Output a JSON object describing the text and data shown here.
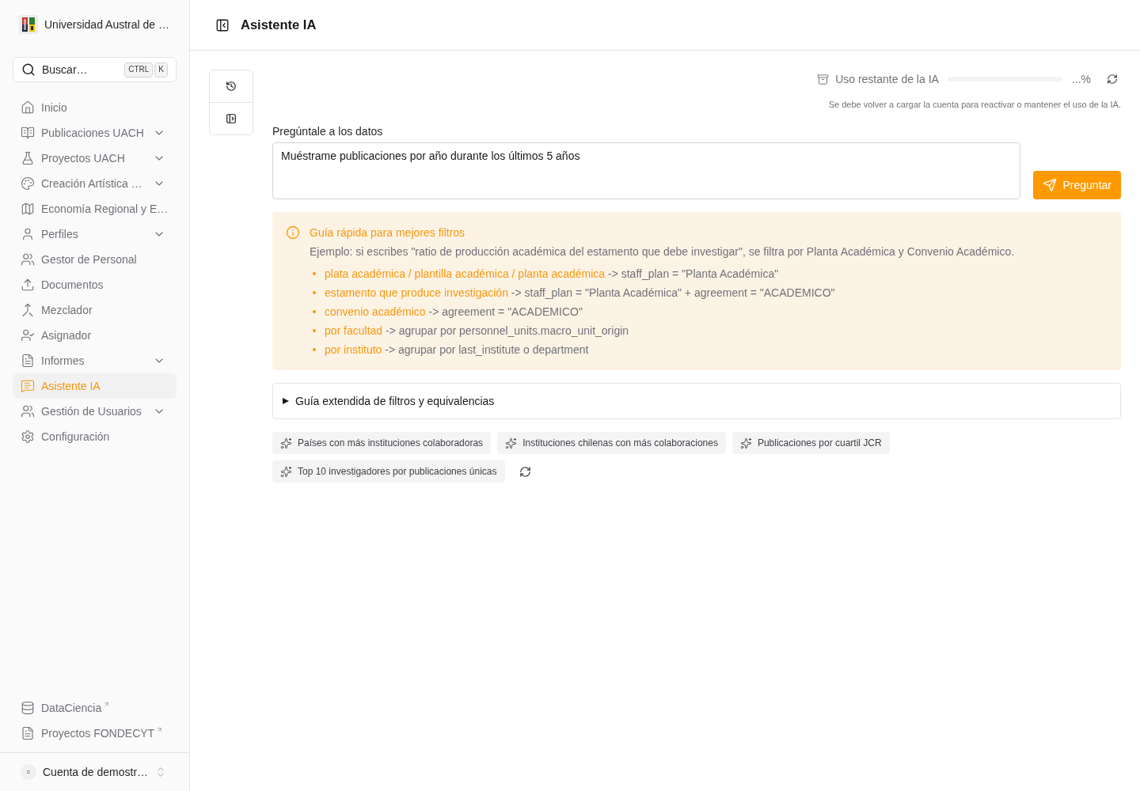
{
  "sidebar": {
    "organization": "Universidad Austral de …",
    "search": {
      "label": "Buscar…",
      "shortcut": [
        "CTRL",
        "K"
      ]
    },
    "nav_items": [
      {
        "label": "Inicio",
        "submenu": false,
        "selected": false
      },
      {
        "label": "Publicaciones UACH",
        "submenu": true,
        "selected": false
      },
      {
        "label": "Proyectos UACH",
        "submenu": true,
        "selected": false
      },
      {
        "label": "Creación Artística …",
        "submenu": true,
        "selected": false
      },
      {
        "label": "Economía Regional y E…",
        "submenu": false,
        "selected": false
      },
      {
        "label": "Perfiles",
        "submenu": true,
        "selected": false
      },
      {
        "label": "Gestor de Personal",
        "submenu": false,
        "selected": false
      },
      {
        "label": "Documentos",
        "submenu": false,
        "selected": false
      },
      {
        "label": "Mezclador",
        "submenu": false,
        "selected": false
      },
      {
        "label": "Asignador",
        "submenu": false,
        "selected": false
      },
      {
        "label": "Informes",
        "submenu": true,
        "selected": false
      },
      {
        "label": "Asistente IA",
        "submenu": false,
        "selected": true
      },
      {
        "label": "Gestión de Usuarios",
        "submenu": true,
        "selected": false
      },
      {
        "label": "Configuración",
        "submenu": false,
        "selected": false
      }
    ],
    "external_links": [
      {
        "label": "DataCiencia"
      },
      {
        "label": "Proyectos FONDECYT"
      }
    ],
    "account": {
      "initial": "c",
      "name": "Cuenta de demostr…"
    }
  },
  "header": {
    "title": "Asistente IA"
  },
  "usage": {
    "label": "Uso restante de la IA",
    "level": 0,
    "reading": "...%",
    "note": "Se debe volver a cargar la cuenta para reactivar o mantener el uso de la IA."
  },
  "query": {
    "label": "Pregúntale a los datos",
    "value": "Muéstrame publicaciones por año durante los últimos 5 años",
    "submit": "Preguntar"
  },
  "quick_guide": {
    "title": "Guía rápida para mejores filtros",
    "example": "Ejemplo: si escribes \"ratio de producción académica del estamento que debe investigar\", se filtra por Planta Académica y Convenio Académico.",
    "rules": [
      {
        "term": "plata académica / plantilla académica / planta académica",
        "mapping": " -> staff_plan = \"Planta Académica\""
      },
      {
        "term": "estamento que produce investigación",
        "mapping": " -> staff_plan = \"Planta Académica\" + agreement = \"ACADEMICO\""
      },
      {
        "term": "convenio académico",
        "mapping": " -> agreement = \"ACADEMICO\""
      },
      {
        "term": "por facultad",
        "mapping": " -> agrupar por personnel_units.macro_unit_origin"
      },
      {
        "term": "por instituto",
        "mapping": " -> agrupar por last_institute o department"
      }
    ]
  },
  "extended_guide": {
    "label": "Guía extendida de filtros y equivalencias",
    "expanded": false
  },
  "suggestions": [
    "Países con más instituciones colaboradoras",
    "Instituciones chilenas con más colaboraciones",
    "Publicaciones por cuartil JCR",
    "Top 10 investigadores por publicaciones únicas"
  ]
}
